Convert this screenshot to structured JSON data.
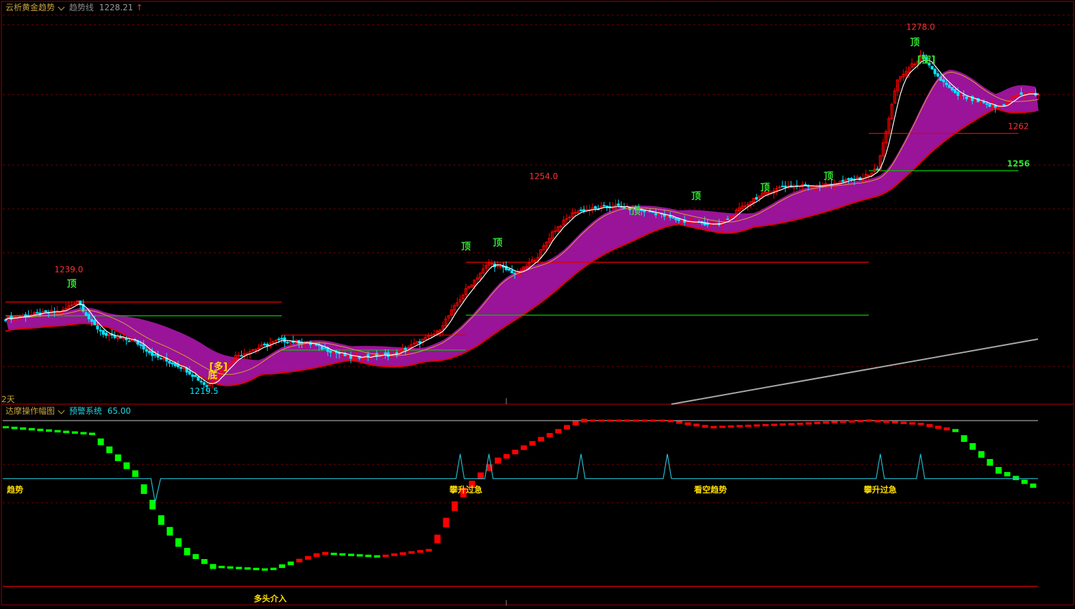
{
  "top_panel": {
    "indicator_name": "云析黄金趋势",
    "line_label": "趋势线",
    "line_value": "1228.21",
    "arrow": "↑",
    "period_label": "2天"
  },
  "bottom_panel": {
    "indicator_name": "达摩操作幅图",
    "line_label": "预警系统",
    "line_value": "65.00"
  },
  "colors": {
    "up": "#ff0000",
    "down": "#00e5ff",
    "highlight": "#ffee00",
    "cloud": "#b418b4",
    "support": "#00c000",
    "resistance": "#e00000",
    "ma_short": "#ffffff",
    "ma_mid": "#d6a030",
    "baseline": "#aaaaaa",
    "warning": "#21c0d0",
    "osc_up": "#ff0000",
    "osc_down": "#00ff00"
  },
  "chart_data": [
    {
      "type": "candlestick",
      "price_annotations": [
        {
          "text": "1239.0",
          "x": 22,
          "y": 1239.0,
          "color": "red"
        },
        {
          "text": "1254.0",
          "x": 187,
          "y": 1254.0,
          "color": "red"
        },
        {
          "text": "1278.0",
          "x": 318,
          "y": 1278.0,
          "color": "red"
        },
        {
          "text": "1219.5",
          "x": 69,
          "y": 1219.5,
          "color": "cyan"
        },
        {
          "text": "1262",
          "x": 352,
          "y": 1262,
          "color": "red"
        },
        {
          "text": "1256",
          "x": 352,
          "y": 1256,
          "color": "green"
        }
      ],
      "signal_annotations": [
        {
          "text": "顶",
          "x": 23,
          "y": 1237.3
        },
        {
          "text": "顶",
          "x": 160,
          "y": 1243.3
        },
        {
          "text": "顶",
          "x": 171,
          "y": 1243.9
        },
        {
          "text": "顶",
          "x": 219,
          "y": 1249.0
        },
        {
          "text": "顶",
          "x": 240,
          "y": 1251.4
        },
        {
          "text": "顶",
          "x": 264,
          "y": 1252.8
        },
        {
          "text": "顶",
          "x": 286,
          "y": 1254.6
        },
        {
          "text": "顶",
          "x": 316,
          "y": 1276.1
        },
        {
          "text": "[空]",
          "x": 320,
          "y": 1273.3
        },
        {
          "text": "[多]",
          "x": 74,
          "y": 1224.0
        },
        {
          "text": "底",
          "x": 72,
          "y": 1222.6
        }
      ],
      "levels": [
        {
          "value": 1234.9,
          "from": 0,
          "to": 96,
          "kind": "resistance"
        },
        {
          "value": 1232.7,
          "from": 0,
          "to": 96,
          "kind": "support"
        },
        {
          "value": 1229.6,
          "from": 96,
          "to": 160,
          "kind": "resistance"
        },
        {
          "value": 1227.2,
          "from": 96,
          "to": 160,
          "kind": "support"
        },
        {
          "value": 1241.3,
          "from": 160,
          "to": 300,
          "kind": "resistance"
        },
        {
          "value": 1232.8,
          "from": 160,
          "to": 300,
          "kind": "support"
        },
        {
          "value": 1262,
          "from": 300,
          "to": 352,
          "kind": "resistance"
        },
        {
          "value": 1256,
          "from": 300,
          "to": 352,
          "kind": "support"
        }
      ],
      "y_range": [
        1218.5,
        1281.0
      ],
      "x_range": [
        0,
        360
      ],
      "grid": true
    },
    {
      "type": "line",
      "series": [
        {
          "name": "预警系统",
          "value": 65.0
        }
      ],
      "zone_labels": [
        {
          "text": "趋势",
          "x": 0
        },
        {
          "text": "攀升过急",
          "x": 160
        },
        {
          "text": "看空趋势",
          "x": 245
        },
        {
          "text": "攀升过急",
          "x": 304
        },
        {
          "text": "多头介入",
          "x": 92
        }
      ],
      "y_range": [
        0,
        100
      ],
      "grid": true
    }
  ]
}
